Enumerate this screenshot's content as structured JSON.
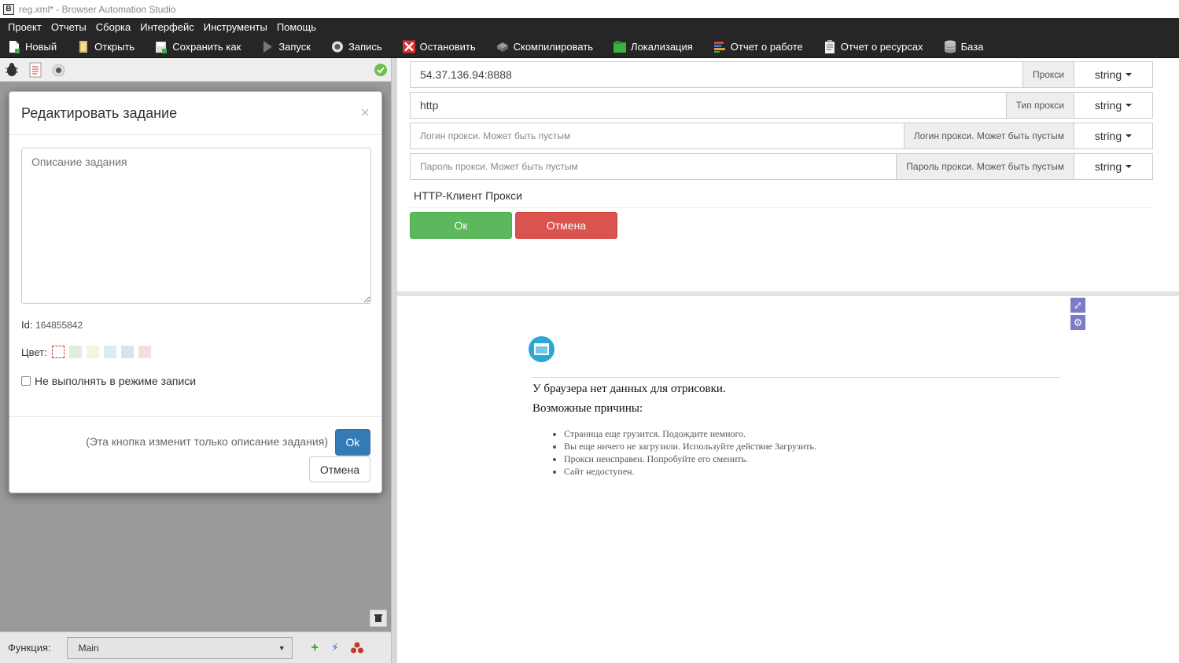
{
  "window": {
    "title": "reg.xml* - Browser Automation Studio",
    "icon_letter": "B"
  },
  "menu": [
    "Проект",
    "Отчеты",
    "Сборка",
    "Интерфейс",
    "Инструменты",
    "Помощь"
  ],
  "toolbar": {
    "new": "Новый",
    "open": "Открыть",
    "save_as": "Сохранить как",
    "run": "Запуск",
    "record": "Запись",
    "stop": "Остановить",
    "compile": "Скомпилировать",
    "localization": "Локализация",
    "work_report": "Отчет о работе",
    "resource_report": "Отчет о ресурсах",
    "database": "База"
  },
  "left": {
    "function_label": "Функция:",
    "function_value": "Main"
  },
  "modal": {
    "title": "Редактировать задание",
    "close": "×",
    "description_placeholder": "Описание задания",
    "id_label": "Id:",
    "id_value": "164855842",
    "color_label": "Цвет:",
    "colors": [
      "none",
      "#dff0d8",
      "#f5f5dc",
      "#d9edf7",
      "#d5e3f5",
      "#fadcdc"
    ],
    "skip_label": "Не выполнять в режиме записи",
    "note": "(Эта кнопка изменит только описание задания)",
    "ok": "Ok",
    "cancel": "Отмена"
  },
  "form": {
    "rows": [
      {
        "value": "54.37.136.94:8888",
        "placeholder": false,
        "addon": "Прокси",
        "type": "string"
      },
      {
        "value": "http",
        "placeholder": false,
        "addon": "Тип прокси",
        "type": "string"
      },
      {
        "value": "Логин прокси. Может быть пустым",
        "placeholder": true,
        "addon": "Логин прокси. Может быть пустым",
        "type": "string"
      },
      {
        "value": "Пароль прокси. Может быть пустым",
        "placeholder": true,
        "addon": "Пароль прокси. Может быть пустым",
        "type": "string"
      }
    ],
    "section": "HTTP-Клиент Прокси",
    "ok": "Ок",
    "cancel": "Отмена"
  },
  "browser": {
    "title": "У браузера нет данных для отрисовки.",
    "subtitle": "Возможные причины:",
    "reasons": [
      "Страница еще грузится. Подождите немного.",
      "Вы еще ничего не загрузили. Используйте действие Загрузить.",
      "Прокси неисправен. Попробуйте его сменить.",
      "Сайт недоступен."
    ]
  }
}
